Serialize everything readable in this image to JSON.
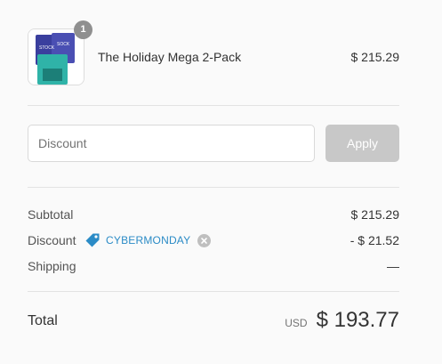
{
  "cart": {
    "items": [
      {
        "quantity": "1",
        "name": "The Holiday Mega 2-Pack",
        "price": "$ 215.29",
        "image_icon": "product-pack-image"
      }
    ]
  },
  "discount": {
    "placeholder": "Discount",
    "value": "",
    "apply_label": "Apply"
  },
  "totals": {
    "subtotal_label": "Subtotal",
    "subtotal_value": "$ 215.29",
    "discount_label": "Discount",
    "discount_code": "CYBERMONDAY",
    "discount_value": "- $ 21.52",
    "shipping_label": "Shipping",
    "shipping_value": "—",
    "total_label": "Total",
    "currency": "USD",
    "total_value": "$ 193.77"
  },
  "colors": {
    "background": "#fafafa",
    "accent": "#2b8bc6",
    "apply_disabled": "#c8c8c8",
    "badge": "#8f8f8f"
  }
}
